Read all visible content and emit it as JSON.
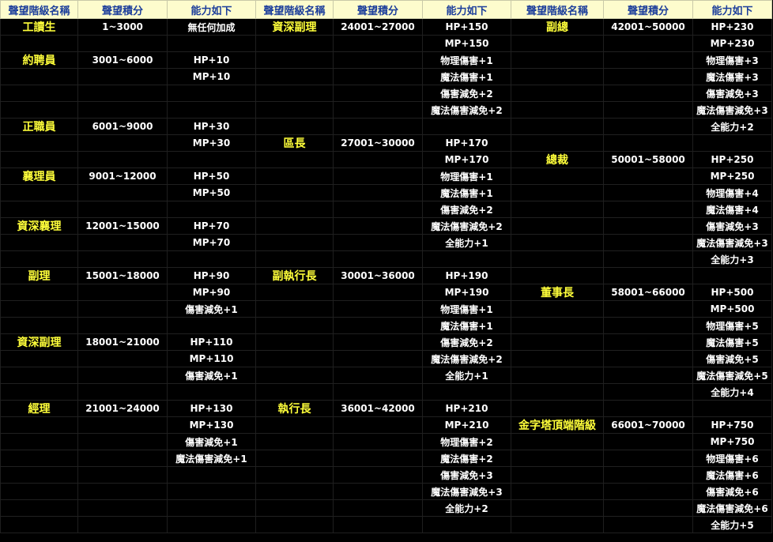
{
  "headers": [
    "聲望階級名稱",
    "聲望積分",
    "能力如下",
    "聲望階級名稱",
    "聲望積分",
    "能力如下",
    "聲望階級名稱",
    "聲望積分",
    "能力如下"
  ],
  "rows": [
    [
      "工讀生",
      "1~3000",
      "無任何加成",
      "資深副理",
      "24001~27000",
      "HP+150",
      "副總",
      "42001~50000",
      "HP+230"
    ],
    [
      "",
      "",
      "",
      "",
      "",
      "MP+150",
      "",
      "",
      "MP+230"
    ],
    [
      "約聘員",
      "3001~6000",
      "HP+10",
      "",
      "",
      "物理傷害+1",
      "",
      "",
      "物理傷害+3"
    ],
    [
      "",
      "",
      "MP+10",
      "",
      "",
      "魔法傷害+1",
      "",
      "",
      "魔法傷害+3"
    ],
    [
      "",
      "",
      "",
      "",
      "",
      "傷害減免+2",
      "",
      "",
      "傷害減免+3"
    ],
    [
      "",
      "",
      "",
      "",
      "",
      "魔法傷害減免+2",
      "",
      "",
      "魔法傷害減免+3"
    ],
    [
      "正職員",
      "6001~9000",
      "HP+30",
      "",
      "",
      "",
      "",
      "",
      "全能力+2"
    ],
    [
      "",
      "",
      "MP+30",
      "區長",
      "27001~30000",
      "HP+170",
      "",
      "",
      ""
    ],
    [
      "",
      "",
      "",
      "",
      "",
      "MP+170",
      "總裁",
      "50001~58000",
      "HP+250"
    ],
    [
      "襄理員",
      "9001~12000",
      "HP+50",
      "",
      "",
      "物理傷害+1",
      "",
      "",
      "MP+250"
    ],
    [
      "",
      "",
      "MP+50",
      "",
      "",
      "魔法傷害+1",
      "",
      "",
      "物理傷害+4"
    ],
    [
      "",
      "",
      "",
      "",
      "",
      "傷害減免+2",
      "",
      "",
      "魔法傷害+4"
    ],
    [
      "資深襄理",
      "12001~15000",
      "HP+70",
      "",
      "",
      "魔法傷害減免+2",
      "",
      "",
      "傷害減免+3"
    ],
    [
      "",
      "",
      "MP+70",
      "",
      "",
      "全能力+1",
      "",
      "",
      "魔法傷害減免+3"
    ],
    [
      "",
      "",
      "",
      "",
      "",
      "",
      "",
      "",
      "全能力+3"
    ],
    [
      "副理",
      "15001~18000",
      "HP+90",
      "副執行長",
      "30001~36000",
      "HP+190",
      "",
      "",
      ""
    ],
    [
      "",
      "",
      "MP+90",
      "",
      "",
      "MP+190",
      "董事長",
      "58001~66000",
      "HP+500"
    ],
    [
      "",
      "",
      "傷害減免+1",
      "",
      "",
      "物理傷害+1",
      "",
      "",
      "MP+500"
    ],
    [
      "",
      "",
      "",
      "",
      "",
      "魔法傷害+1",
      "",
      "",
      "物理傷害+5"
    ],
    [
      "資深副理",
      "18001~21000",
      "HP+110",
      "",
      "",
      "傷害減免+2",
      "",
      "",
      "魔法傷害+5"
    ],
    [
      "",
      "",
      "MP+110",
      "",
      "",
      "魔法傷害減免+2",
      "",
      "",
      "傷害減免+5"
    ],
    [
      "",
      "",
      "傷害減免+1",
      "",
      "",
      "全能力+1",
      "",
      "",
      "魔法傷害減免+5"
    ],
    [
      "",
      "",
      "",
      "",
      "",
      "",
      "",
      "",
      "全能力+4"
    ],
    [
      "經理",
      "21001~24000",
      "HP+130",
      "執行長",
      "36001~42000",
      "HP+210",
      "",
      "",
      ""
    ],
    [
      "",
      "",
      "MP+130",
      "",
      "",
      "MP+210",
      "金字塔頂端階級",
      "66001~70000",
      "HP+750"
    ],
    [
      "",
      "",
      "傷害減免+1",
      "",
      "",
      "物理傷害+2",
      "",
      "",
      "MP+750"
    ],
    [
      "",
      "",
      "魔法傷害減免+1",
      "",
      "",
      "魔法傷害+2",
      "",
      "",
      "物理傷害+6"
    ],
    [
      "",
      "",
      "",
      "",
      "",
      "傷害減免+3",
      "",
      "",
      "魔法傷害+6"
    ],
    [
      "",
      "",
      "",
      "",
      "",
      "魔法傷害減免+3",
      "",
      "",
      "傷害減免+6"
    ],
    [
      "",
      "",
      "",
      "",
      "",
      "全能力+2",
      "",
      "",
      "魔法傷害減免+6"
    ],
    [
      "",
      "",
      "",
      "",
      "",
      "",
      "",
      "",
      "全能力+5"
    ]
  ]
}
